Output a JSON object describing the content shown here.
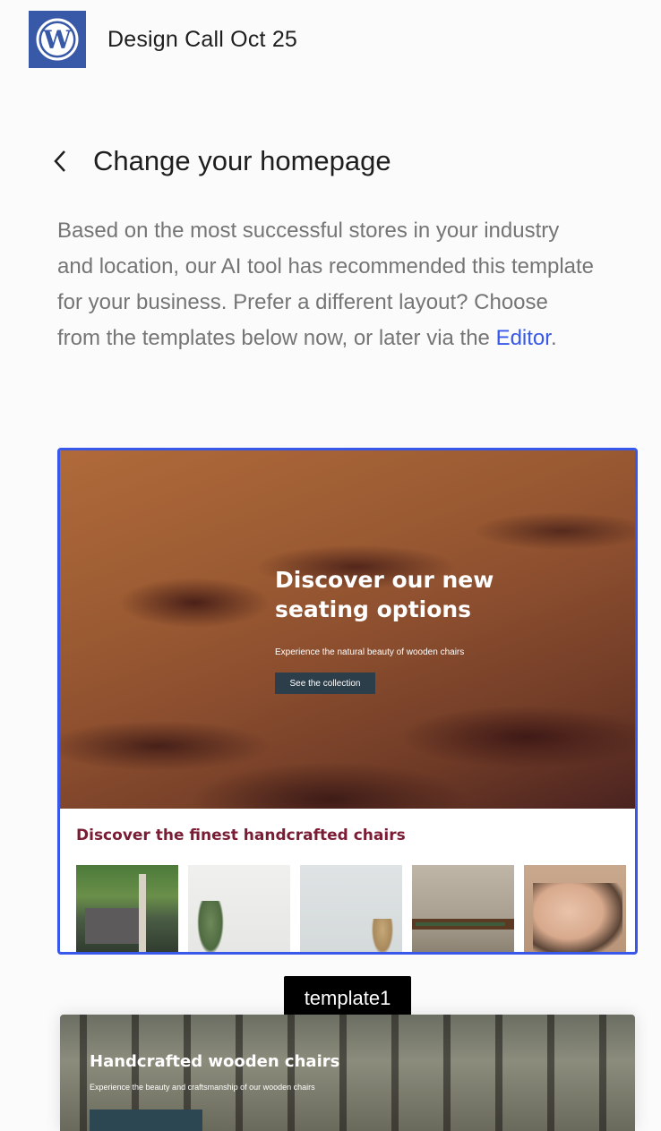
{
  "header": {
    "site_title": "Design Call Oct 25",
    "logo_icon": "wordpress-logo-icon"
  },
  "panel": {
    "back_icon": "chevron-left-icon",
    "title": "Change your homepage",
    "description_text": "Based on the most successful stores in your industry and location, our AI tool has recommended this template for your business. Prefer a different layout? Choose from the templates below now, or later via the ",
    "editor_link": "Editor",
    "description_end": "."
  },
  "templates": [
    {
      "hero_heading": "Discover our new seating options",
      "hero_subtitle": "Experience the natural beauty of wooden chairs",
      "hero_button": "See the collection",
      "section_heading": "Discover the finest handcrafted chairs",
      "selected": true
    },
    {
      "hero_heading": "Handcrafted wooden chairs",
      "hero_subtitle": "Experience the beauty and craftsmanship of our wooden chairs"
    }
  ],
  "tooltip": "template1",
  "colors": {
    "accent": "#3858e9",
    "logo_bg": "#3858a8",
    "section_heading": "#7a1c34",
    "button_dark": "#2c3e4a"
  }
}
